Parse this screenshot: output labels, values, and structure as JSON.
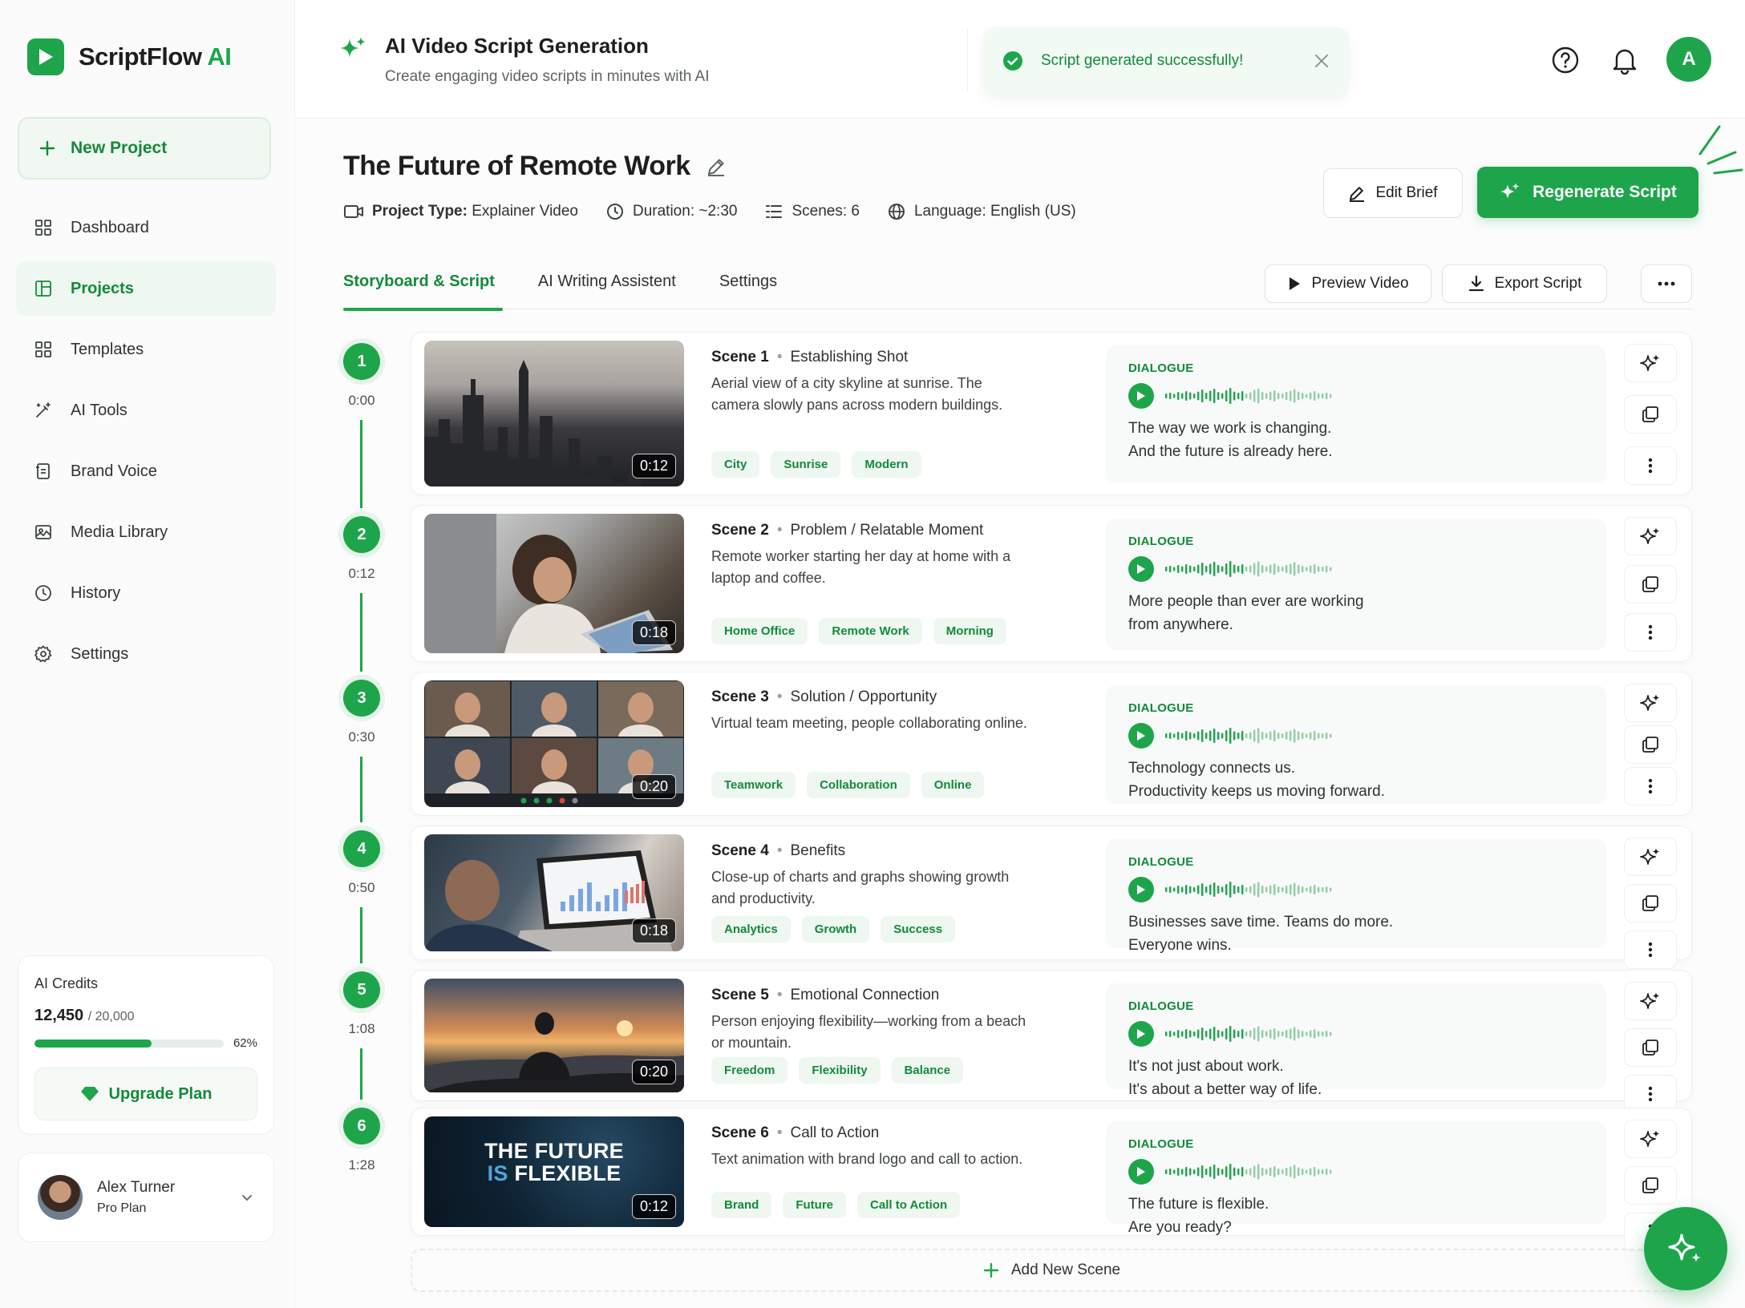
{
  "brand": {
    "name": "ScriptFlow",
    "suffix": "AI"
  },
  "sidebar": {
    "new_project": "New Project",
    "items": [
      {
        "label": "Dashboard",
        "icon": "dashboard-icon"
      },
      {
        "label": "Projects",
        "icon": "projects-icon",
        "active": true
      },
      {
        "label": "Templates",
        "icon": "templates-icon"
      },
      {
        "label": "AI Tools",
        "icon": "ai-tools-icon"
      },
      {
        "label": "Brand Voice",
        "icon": "brand-voice-icon"
      },
      {
        "label": "Media Library",
        "icon": "media-library-icon"
      },
      {
        "label": "History",
        "icon": "history-icon"
      },
      {
        "label": "Settings",
        "icon": "settings-icon"
      }
    ],
    "credits": {
      "title": "AI Credits",
      "used": "12,450",
      "total": "/ 20,000",
      "percent_label": "62%",
      "fraction": 0.62,
      "upgrade": "Upgrade Plan"
    },
    "user": {
      "name": "Alex Turner",
      "plan": "Pro Plan"
    }
  },
  "header": {
    "title": "AI Video Script Generation",
    "subtitle": "Create engaging video scripts in minutes with AI",
    "toast": "Script generated successfully!",
    "avatar_initial": "A"
  },
  "project": {
    "title": "The Future of Remote Work",
    "meta": {
      "type_label": "Project Type:",
      "type_value": "Explainer Video",
      "duration": "Duration: ~2:30",
      "scenes": "Scenes: 6",
      "language": "Language: English (US)"
    },
    "edit_brief": "Edit Brief",
    "regenerate": "Regenerate Script"
  },
  "tabs": [
    "Storyboard & Script",
    "AI Writing Assistent",
    "Settings"
  ],
  "toolbar": {
    "preview": "Preview Video",
    "export": "Export Script"
  },
  "dialogue_label": "DIALOGUE",
  "scenes": [
    {
      "num": "1",
      "time": "0:00",
      "title": "Scene 1",
      "type": "Establishing Shot",
      "desc": "Aerial view of a city skyline at sunrise. The camera slowly pans across modern buildings.",
      "tags": [
        "City",
        "Sunrise",
        "Modern"
      ],
      "duration": "0:12",
      "line1": "The way we work is changing.",
      "line2": "And the future is already here."
    },
    {
      "num": "2",
      "time": "0:12",
      "title": "Scene 2",
      "type": "Problem / Relatable Moment",
      "desc": "Remote worker starting her day at home with a laptop and coffee.",
      "tags": [
        "Home Office",
        "Remote Work",
        "Morning"
      ],
      "duration": "0:18",
      "line1": "More people than ever are working",
      "line2": "from anywhere."
    },
    {
      "num": "3",
      "time": "0:30",
      "title": "Scene 3",
      "type": "Solution / Opportunity",
      "desc": "Virtual team meeting, people collaborating online.",
      "tags": [
        "Teamwork",
        "Collaboration",
        "Online"
      ],
      "duration": "0:20",
      "line1": "Technology connects us.",
      "line2": "Productivity keeps us moving forward."
    },
    {
      "num": "4",
      "time": "0:50",
      "title": "Scene 4",
      "type": "Benefits",
      "desc": "Close-up of charts and graphs showing growth and productivity.",
      "tags": [
        "Analytics",
        "Growth",
        "Success"
      ],
      "duration": "0:18",
      "line1": "Businesses save time. Teams do more.",
      "line2": "Everyone wins."
    },
    {
      "num": "5",
      "time": "1:08",
      "title": "Scene 5",
      "type": "Emotional Connection",
      "desc": "Person enjoying flexibility—working from a beach or mountain.",
      "tags": [
        "Freedom",
        "Flexibility",
        "Balance"
      ],
      "duration": "0:20",
      "line1": "It's not just about work.",
      "line2": "It's about a better way of life."
    },
    {
      "num": "6",
      "time": "1:28",
      "title": "Scene 6",
      "type": "Call to Action",
      "desc": "Text animation with brand logo and call to action.",
      "tags": [
        "Brand",
        "Future",
        "Call to Action"
      ],
      "duration": "0:12",
      "line1": "The future is flexible.",
      "line2": "Are you ready?",
      "thumb_line1": "THE FUTURE",
      "thumb_line2a": "IS",
      "thumb_line2b": "FLEXIBLE"
    }
  ],
  "add_scene": "Add New Scene",
  "colors": {
    "accent": "#1ea54b",
    "accent_dark": "#138a3a"
  }
}
